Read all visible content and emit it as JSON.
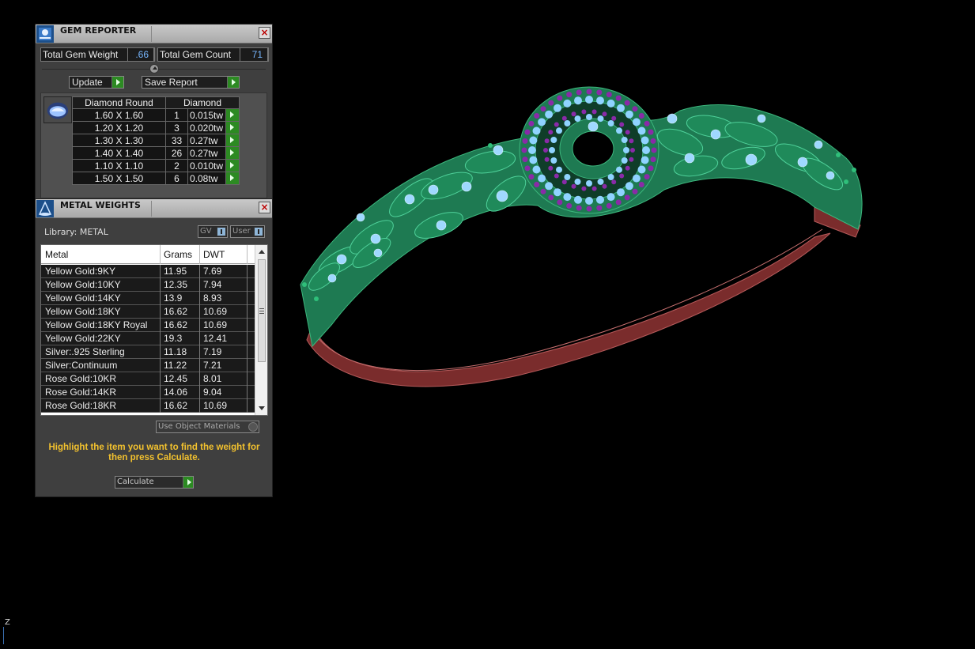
{
  "gem_reporter": {
    "title": "GEM REPORTER",
    "total_weight_label": "Total Gem Weight",
    "total_weight_value": ".66",
    "total_count_label": "Total Gem Count",
    "total_count_value": "71",
    "update_label": "Update",
    "save_report_label": "Save Report",
    "table": {
      "headers": [
        "Diamond Round",
        "Diamond"
      ],
      "rows": [
        {
          "size": "1.60 X 1.60",
          "count": "1",
          "weight": "0.015tw"
        },
        {
          "size": "1.20 X 1.20",
          "count": "3",
          "weight": "0.020tw"
        },
        {
          "size": "1.30 X 1.30",
          "count": "33",
          "weight": "0.27tw"
        },
        {
          "size": "1.40 X 1.40",
          "count": "26",
          "weight": "0.27tw"
        },
        {
          "size": "1.10 X 1.10",
          "count": "2",
          "weight": "0.010tw"
        },
        {
          "size": "1.50 X 1.50",
          "count": "6",
          "weight": "0.08tw"
        }
      ]
    }
  },
  "metal_weights": {
    "title": "METAL WEIGHTS",
    "library_label": "Library: METAL",
    "gv_label": "GV",
    "user_label": "User",
    "columns": [
      "Metal",
      "Grams",
      "DWT"
    ],
    "rows": [
      {
        "metal": "Yellow Gold:9KY",
        "grams": "11.95",
        "dwt": "7.69"
      },
      {
        "metal": "Yellow Gold:10KY",
        "grams": "12.35",
        "dwt": "7.94"
      },
      {
        "metal": "Yellow Gold:14KY",
        "grams": "13.9",
        "dwt": "8.93"
      },
      {
        "metal": "Yellow Gold:18KY",
        "grams": "16.62",
        "dwt": "10.69"
      },
      {
        "metal": "Yellow Gold:18KY Royal",
        "grams": "16.62",
        "dwt": "10.69"
      },
      {
        "metal": "Yellow Gold:22KY",
        "grams": "19.3",
        "dwt": "12.41"
      },
      {
        "metal": "Silver:.925 Sterling",
        "grams": "11.18",
        "dwt": "7.19"
      },
      {
        "metal": "Silver:Continuum",
        "grams": "11.22",
        "dwt": "7.21"
      },
      {
        "metal": "Rose Gold:10KR",
        "grams": "12.45",
        "dwt": "8.01"
      },
      {
        "metal": "Rose Gold:14KR",
        "grams": "14.06",
        "dwt": "9.04"
      },
      {
        "metal": "Rose Gold:18KR",
        "grams": "16.62",
        "dwt": "10.69"
      }
    ],
    "use_object_materials_label": "Use Object Materials",
    "hint_text": "Highlight the item you want to find the weight for then press Calculate.",
    "calculate_label": "Calculate"
  },
  "viewport": {
    "axis_label": "Z"
  },
  "colors": {
    "metal_green": "#1e7a52",
    "shank_red": "#8a3030",
    "gem_blue": "#8fd3ff",
    "gem_purple": "#8a2aa8",
    "accent_green": "#2c8a22",
    "hint_yellow": "#f2c12e"
  }
}
